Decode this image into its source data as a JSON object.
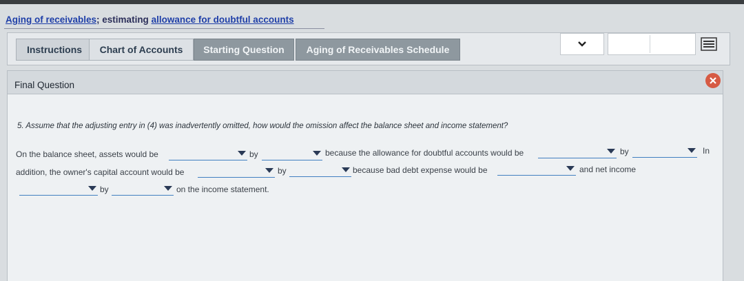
{
  "header": {
    "title_part1": "Aging of receivables",
    "title_sep": "; estimating ",
    "title_part2": "allowance for doubtful accounts"
  },
  "tabs": [
    {
      "label": "Instructions"
    },
    {
      "label": "Chart of Accounts"
    },
    {
      "label": "Starting Question"
    },
    {
      "label": "Aging of Receivables Schedule"
    }
  ],
  "nav": {
    "select_icon": "chevron-down-icon",
    "list_icon": "list-icon"
  },
  "panel": {
    "title": "Final Question",
    "close_icon": "close-icon",
    "question": "5. Assume that the adjusting entry in (4) was inadvertently omitted, how would the omission affect the balance sheet and income statement?",
    "sentence": {
      "t1": "On the balance sheet, assets would be",
      "by1": "by",
      "t2": "because the allowance for doubtful accounts would be",
      "by2": "by",
      "t3": "In",
      "t4": "addition, the owner's capital account would be",
      "by3": "by",
      "t5": "because bad debt expense would be",
      "t6": "and net income",
      "by4": "by",
      "t7": "on the income statement."
    }
  },
  "colors": {
    "accent": "#3f7ec0",
    "tab_dark": "#8e989f",
    "close": "#d65a43"
  }
}
